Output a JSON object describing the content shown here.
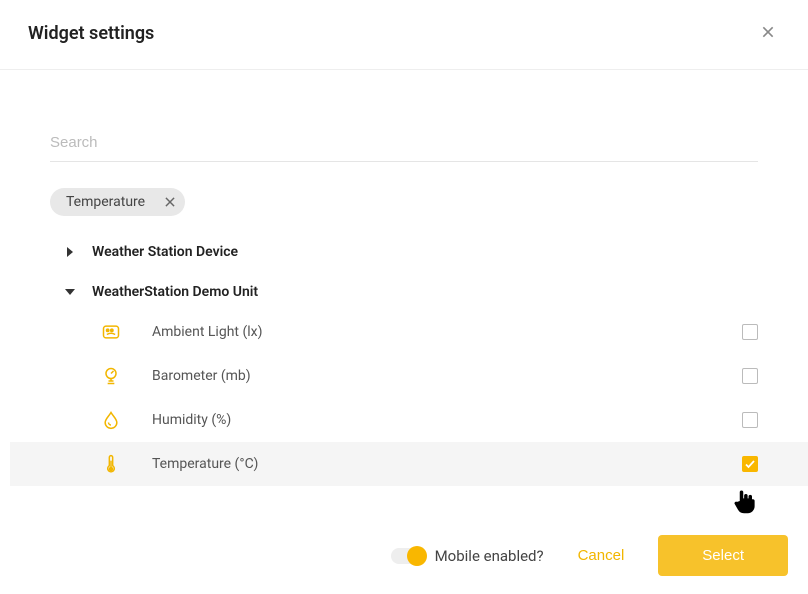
{
  "header": {
    "title": "Widget settings"
  },
  "search": {
    "placeholder": "Search",
    "value": ""
  },
  "chip": {
    "label": "Temperature"
  },
  "tree": {
    "collapsed": {
      "label": "Weather Station Device"
    },
    "expanded": {
      "label": "WeatherStation Demo Unit"
    }
  },
  "sensors": {
    "ambient": {
      "label": "Ambient Light (lx)",
      "checked": false
    },
    "barometer": {
      "label": "Barometer (mb)",
      "checked": false
    },
    "humidity": {
      "label": "Humidity (%)",
      "checked": false
    },
    "temperature": {
      "label": "Temperature (°C)",
      "checked": true
    }
  },
  "footer": {
    "mobile_label": "Mobile enabled?",
    "cancel": "Cancel",
    "select": "Select"
  }
}
